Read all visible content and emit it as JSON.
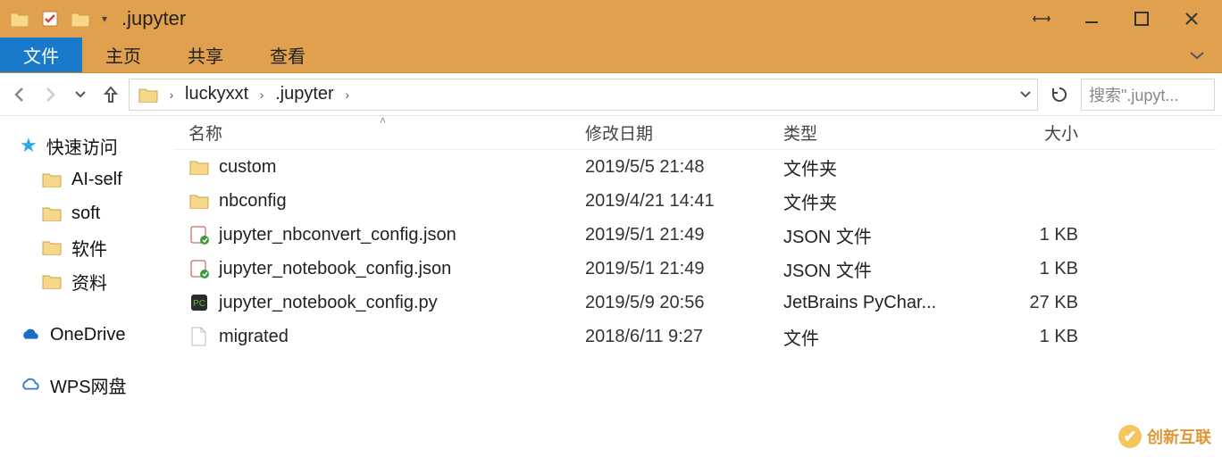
{
  "window": {
    "title": ".jupyter",
    "qat_drop_glyph": "▾"
  },
  "ribbon": {
    "file": "文件",
    "home": "主页",
    "share": "共享",
    "view": "查看"
  },
  "breadcrumb": {
    "segments": [
      "luckyxxt",
      ".jupyter"
    ],
    "search_placeholder": "搜索\".jupyt..."
  },
  "columns": {
    "name": "名称",
    "date": "修改日期",
    "type": "类型",
    "size": "大小"
  },
  "sidebar": {
    "quick_access": "快速访问",
    "items": [
      "AI-self",
      "soft",
      "软件",
      "资料"
    ],
    "onedrive": "OneDrive",
    "wps": "WPS网盘"
  },
  "files": [
    {
      "icon": "folder",
      "name": "custom",
      "date": "2019/5/5 21:48",
      "type": "文件夹",
      "size": ""
    },
    {
      "icon": "folder",
      "name": "nbconfig",
      "date": "2019/4/21 14:41",
      "type": "文件夹",
      "size": ""
    },
    {
      "icon": "json",
      "name": "jupyter_nbconvert_config.json",
      "date": "2019/5/1 21:49",
      "type": "JSON 文件",
      "size": "1 KB"
    },
    {
      "icon": "json",
      "name": "jupyter_notebook_config.json",
      "date": "2019/5/1 21:49",
      "type": "JSON 文件",
      "size": "1 KB"
    },
    {
      "icon": "py",
      "name": "jupyter_notebook_config.py",
      "date": "2019/5/9 20:56",
      "type": "JetBrains PyChar...",
      "size": "27 KB"
    },
    {
      "icon": "file",
      "name": "migrated",
      "date": "2018/6/11 9:27",
      "type": "文件",
      "size": "1 KB"
    }
  ],
  "watermark": "创新互联"
}
